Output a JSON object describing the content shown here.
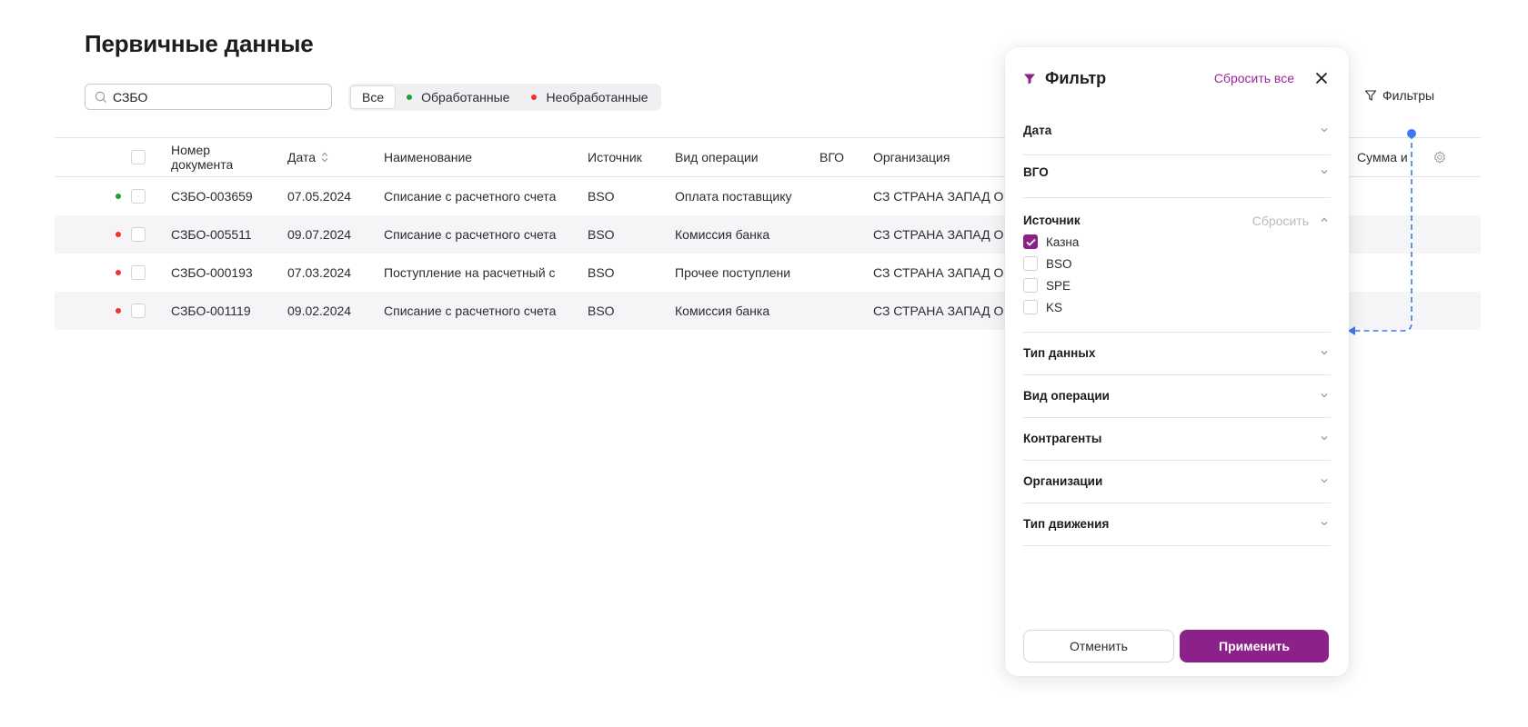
{
  "page": {
    "title": "Первичные данные"
  },
  "search": {
    "value": "СЗБО",
    "placeholder": ""
  },
  "segments": {
    "all": "Все",
    "processed": "Обработанные",
    "unprocessed": "Необработанные"
  },
  "filters_button": {
    "label": "Фильтры"
  },
  "colors": {
    "accent": "#8c2189",
    "processed": "#1ea032",
    "unprocessed": "#f03232",
    "connector": "#3d79f0"
  },
  "table": {
    "headers": {
      "doc_no_1": "Номер",
      "doc_no_2": "документа",
      "date": "Дата",
      "name": "Наименование",
      "source": "Источник",
      "operation": "Вид операции",
      "vgo": "ВГО",
      "org": "Организация",
      "sum": "Сумма и"
    },
    "rows": [
      {
        "status": "processed",
        "doc": "СЗБО-003659",
        "date": "07.05.2024",
        "name": "Списание с расчетного счета",
        "source": "BSO",
        "operation": "Оплата поставщику",
        "org": "СЗ СТРАНА ЗАПАД О"
      },
      {
        "status": "unprocessed",
        "doc": "СЗБО-005511",
        "date": "09.07.2024",
        "name": "Списание с расчетного счета",
        "source": "BSO",
        "operation": "Комиссия банка",
        "org": "СЗ СТРАНА ЗАПАД О"
      },
      {
        "status": "unprocessed",
        "doc": "СЗБО-000193",
        "date": "07.03.2024",
        "name": "Поступление на расчетный с",
        "source": "BSO",
        "operation": "Прочее поступлени",
        "org": "СЗ СТРАНА ЗАПАД О"
      },
      {
        "status": "unprocessed",
        "doc": "СЗБО-001119",
        "date": "09.02.2024",
        "name": "Списание с расчетного счета",
        "source": "BSO",
        "operation": "Комиссия банка",
        "org": "СЗ СТРАНА ЗАПАД О"
      }
    ]
  },
  "filter_panel": {
    "title": "Фильтр",
    "reset_all": "Сбросить все",
    "sections": {
      "date": "Дата",
      "vgo": "ВГО",
      "source": "Источник",
      "source_reset": "Сбросить",
      "data_type": "Тип данных",
      "operation": "Вид операции",
      "contractors": "Контрагенты",
      "organizations": "Организации",
      "movement": "Тип движения"
    },
    "source_options": [
      {
        "label": "Казна",
        "checked": true
      },
      {
        "label": "BSO",
        "checked": false
      },
      {
        "label": "SPE",
        "checked": false
      },
      {
        "label": "KS",
        "checked": false
      }
    ],
    "cancel": "Отменить",
    "apply": "Применить"
  }
}
